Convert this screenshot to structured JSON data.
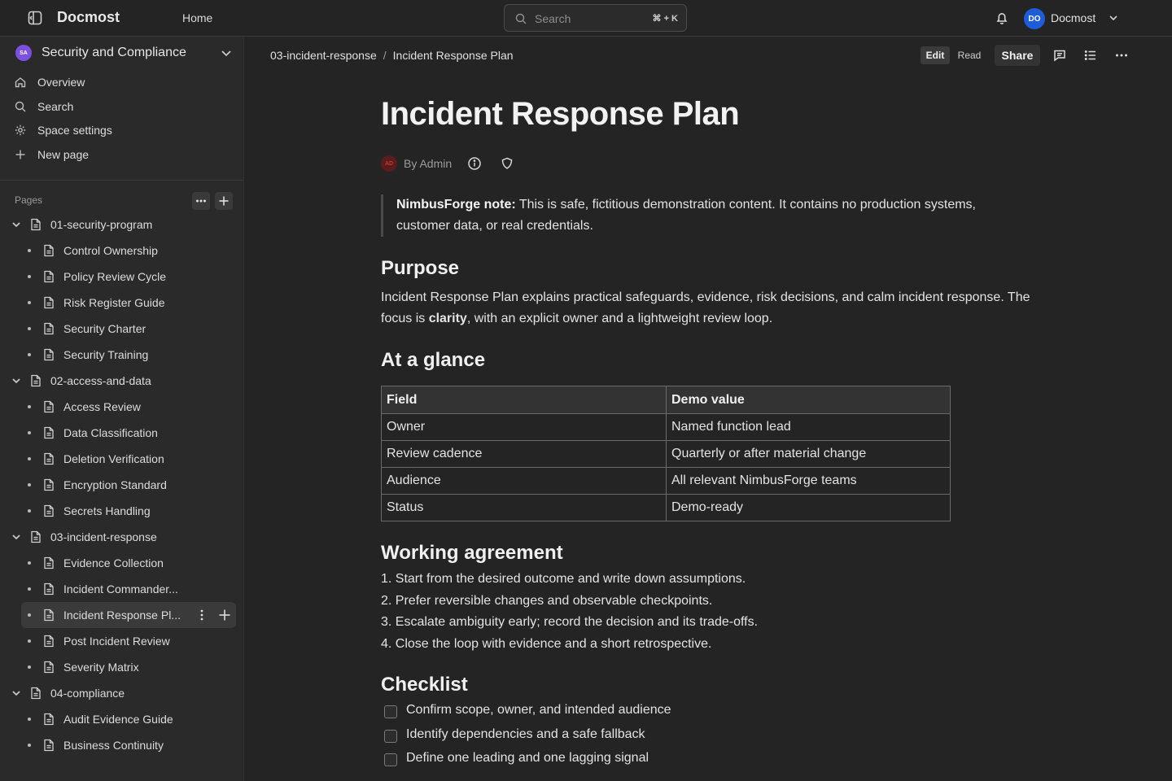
{
  "header": {
    "app_name": "Docmost",
    "home_label": "Home",
    "search_placeholder": "Search",
    "search_shortcut": "⌘ + K",
    "user_initials": "DO",
    "user_name": "Docmost"
  },
  "sidebar": {
    "space_initials": "SA",
    "space_name": "Security and Compliance",
    "nav": [
      {
        "label": "Overview",
        "icon": "home-icon"
      },
      {
        "label": "Search",
        "icon": "search-icon"
      },
      {
        "label": "Space settings",
        "icon": "gear-icon"
      },
      {
        "label": "New page",
        "icon": "plus-icon"
      }
    ],
    "pages_label": "Pages",
    "tree": [
      {
        "label": "01-security-program",
        "level": 0
      },
      {
        "label": "Control Ownership",
        "level": 1
      },
      {
        "label": "Policy Review Cycle",
        "level": 1
      },
      {
        "label": "Risk Register Guide",
        "level": 1
      },
      {
        "label": "Security Charter",
        "level": 1
      },
      {
        "label": "Security Training",
        "level": 1
      },
      {
        "label": "02-access-and-data",
        "level": 0
      },
      {
        "label": "Access Review",
        "level": 1
      },
      {
        "label": "Data Classification",
        "level": 1
      },
      {
        "label": "Deletion Verification",
        "level": 1
      },
      {
        "label": "Encryption Standard",
        "level": 1
      },
      {
        "label": "Secrets Handling",
        "level": 1
      },
      {
        "label": "03-incident-response",
        "level": 0
      },
      {
        "label": "Evidence Collection",
        "level": 1
      },
      {
        "label": "Incident Commander...",
        "level": 1
      },
      {
        "label": "Incident Response Pl...",
        "level": 1,
        "active": true
      },
      {
        "label": "Post Incident Review",
        "level": 1
      },
      {
        "label": "Severity Matrix",
        "level": 1
      },
      {
        "label": "04-compliance",
        "level": 0
      },
      {
        "label": "Audit Evidence Guide",
        "level": 1
      },
      {
        "label": "Business Continuity",
        "level": 1
      }
    ]
  },
  "toolbar": {
    "breadcrumb_parent": "03-incident-response",
    "breadcrumb_sep": "/",
    "breadcrumb_current": "Incident Response Plan",
    "edit_label": "Edit",
    "read_label": "Read",
    "share_label": "Share"
  },
  "doc": {
    "title": "Incident Response Plan",
    "author_initials": "AD",
    "byline": "By Admin",
    "callout_bold": "NimbusForge note:",
    "callout_text": " This is safe, fictitious demonstration content. It contains no production systems, customer data, or real credentials.",
    "purpose_heading": "Purpose",
    "purpose_pre": "Incident Response Plan explains practical safeguards, evidence, risk decisions, and calm incident response. The focus is ",
    "purpose_bold": "clarity",
    "purpose_post": ", with an explicit owner and a lightweight review loop.",
    "glance_heading": "At a glance",
    "table_headers": [
      "Field",
      "Demo value"
    ],
    "table_rows": [
      [
        "Owner",
        "Named function lead"
      ],
      [
        "Review cadence",
        "Quarterly or after material change"
      ],
      [
        "Audience",
        "All relevant NimbusForge teams"
      ],
      [
        "Status",
        "Demo-ready"
      ]
    ],
    "working_heading": "Working agreement",
    "working_items": [
      "1. Start from the desired outcome and write down assumptions.",
      "2. Prefer reversible changes and observable checkpoints.",
      "3. Escalate ambiguity early; record the decision and its trade-offs.",
      "4. Close the loop with evidence and a short retrospective."
    ],
    "checklist_heading": "Checklist",
    "checklist_items": [
      "Confirm scope, owner, and intended audience",
      "Identify dependencies and a safe fallback",
      "Define one leading and one lagging signal"
    ]
  }
}
